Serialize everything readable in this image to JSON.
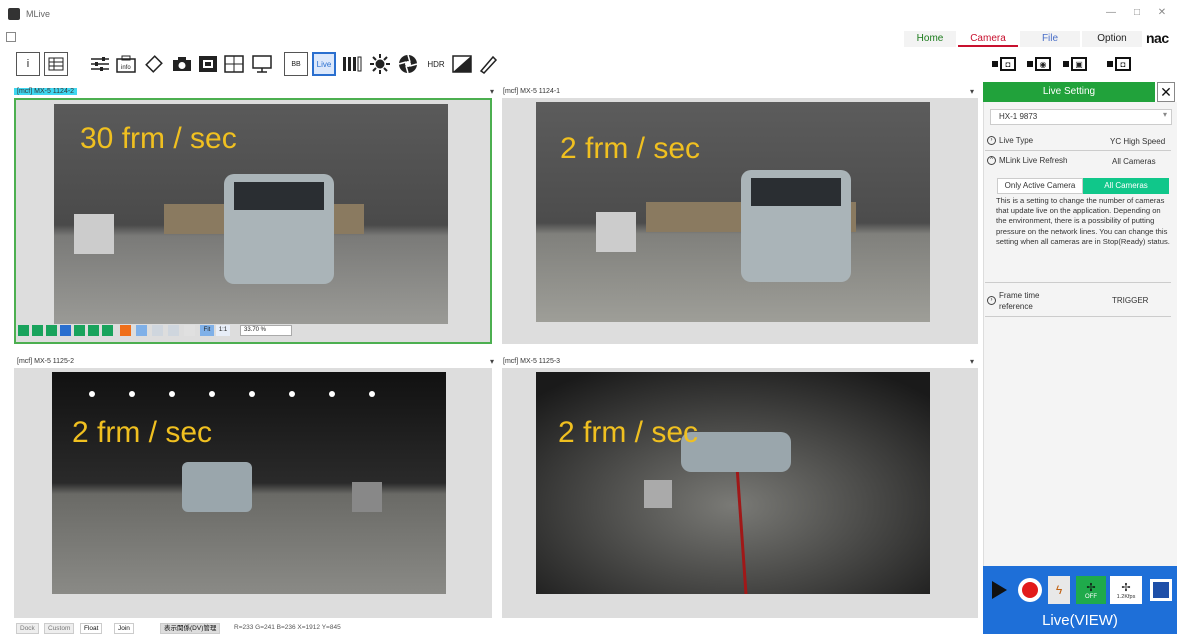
{
  "window": {
    "title": "MLive",
    "minimize": "—",
    "maximize": "□",
    "close": "✕"
  },
  "menu": {
    "home": "Home",
    "camera": "Camera",
    "file": "File",
    "option": "Option",
    "brand": "nac"
  },
  "toolbar": {
    "live_label": "Live",
    "hdr_label": "HDR",
    "info_label": "i",
    "bb_label": "BB"
  },
  "panels": [
    {
      "label": "[mcf] MX-5 1124-2",
      "fps": "30 frm / sec",
      "active": true
    },
    {
      "label": "[mcf] MX-5 1124-1",
      "fps": "2 frm / sec",
      "active": false
    },
    {
      "label": "[mcf] MX-5 1125-2",
      "fps": "2 frm / sec",
      "active": false
    },
    {
      "label": "[mcf] MX-5 1125-3",
      "fps": "2 frm / sec",
      "active": false
    }
  ],
  "playback": {
    "fit_label": "Fit",
    "one_to_one": "1:1",
    "zoom": "33.70 %"
  },
  "live_setting": {
    "header": "Live Setting",
    "close": "✕",
    "camera_select": "HX-1 9873",
    "live_type_label": "Live Type",
    "live_type_value": "YC High Speed",
    "refresh_label": "MLink Live Refresh",
    "refresh_value": "All Cameras",
    "only_active": "Only Active Camera",
    "all_cameras": "All Cameras",
    "description": "This is a setting to change the number of cameras that update live on the application. Depending on the environment, there is a possibility of putting pressure on the network lines. You can change this setting when all cameras are in Stop(Ready) status.",
    "frame_time_label": "Frame time reference",
    "frame_time_value": "TRIGGER"
  },
  "control": {
    "off_label": "OFF",
    "trigger_label": "1.2Kfps",
    "live_view": "Live(VIEW)"
  },
  "status": {
    "dock": "Dock",
    "custom": "Custom",
    "float": "Float",
    "join": "Join",
    "mode": "表示関係(DV)管理",
    "pixel_info": "R=233 G=241 B=236 X=1912 Y=845"
  },
  "colors": {
    "accent_green": "#21a23b",
    "accent_teal": "#10c78a",
    "accent_blue": "#1e6fd8",
    "accent_red": "#c8102e",
    "fps_text": "#f0c020"
  }
}
